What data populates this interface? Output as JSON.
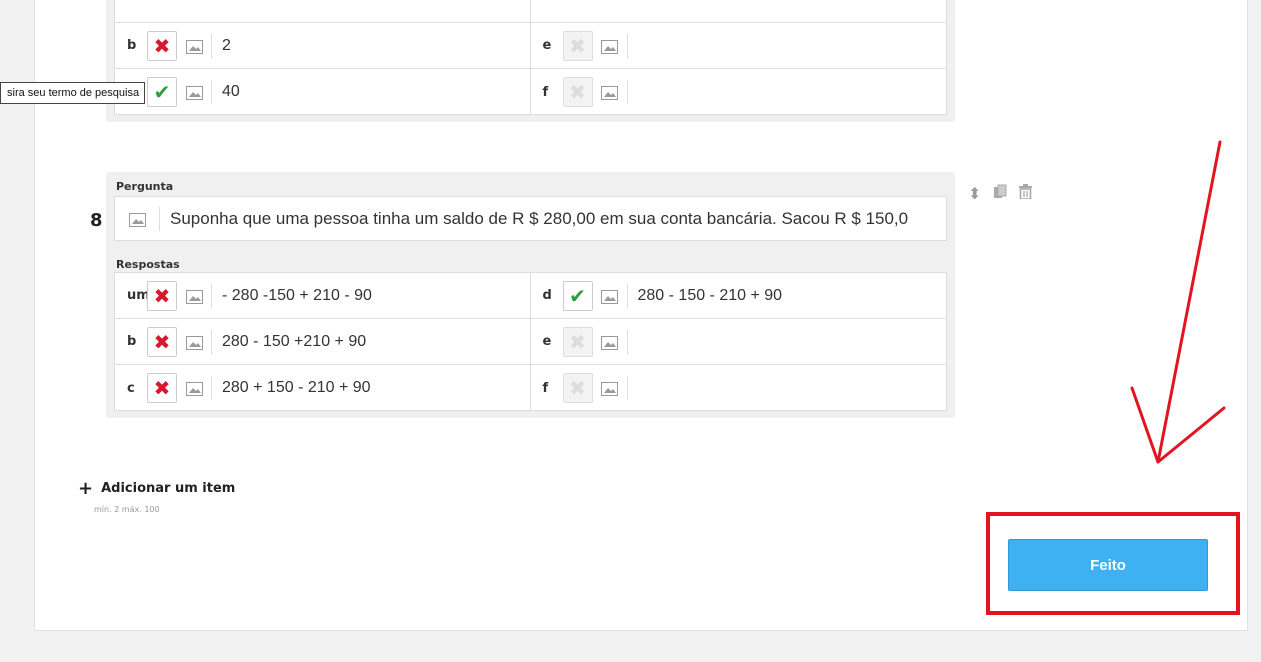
{
  "tooltip": "sira seu termo de pesquisa",
  "previous_question": {
    "rows": [
      {
        "left_letter": "b",
        "left_mark": "x",
        "left_text": "2",
        "right_letter": "e",
        "right_mark": "off",
        "right_text": ""
      },
      {
        "left_letter": "",
        "left_mark": "ok",
        "left_text": "40",
        "right_letter": "f",
        "right_mark": "off",
        "right_text": ""
      }
    ]
  },
  "question": {
    "number": "8",
    "question_label": "Pergunta",
    "text": "Suponha que uma pessoa tinha um saldo de R $ 280,00 em sua conta bancária. Sacou R $ 150,0",
    "answers_label": "Respostas",
    "rows": [
      {
        "left_letter": "um",
        "left_mark": "x",
        "left_text": "- 280 -150 + 210 - 90",
        "right_letter": "d",
        "right_mark": "ok",
        "right_text": "280 - 150 - 210 + 90"
      },
      {
        "left_letter": "b",
        "left_mark": "x",
        "left_text": "280 - 150 +210 + 90",
        "right_letter": "e",
        "right_mark": "off",
        "right_text": ""
      },
      {
        "left_letter": "c",
        "left_mark": "x",
        "left_text": "280 + 150 - 210 + 90",
        "right_letter": "f",
        "right_mark": "off",
        "right_text": ""
      }
    ]
  },
  "icons": {
    "sort": "sort-icon",
    "copy": "copy-icon",
    "trash": "trash-icon",
    "image": "image-icon",
    "x": "cross-icon",
    "ok": "check-icon"
  },
  "add_item": {
    "label": "Adicionar um item",
    "limits": "mín. 2 máx. 100"
  },
  "done_button": "Feito",
  "colors": {
    "primary_button": "#3eb1f3",
    "annotation": "#e2141f",
    "wrong": "#d9182e",
    "correct": "#2e9e3c"
  }
}
